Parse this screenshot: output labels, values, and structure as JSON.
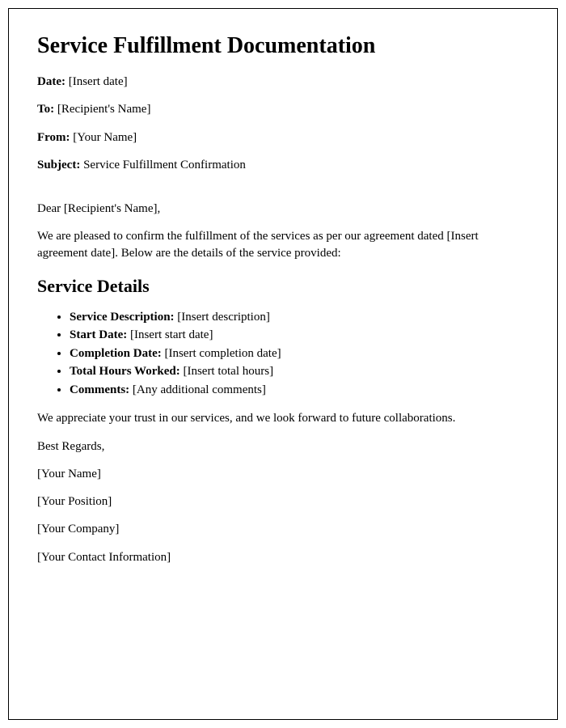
{
  "title": "Service Fulfillment Documentation",
  "header": {
    "date_label": "Date:",
    "date_value": " [Insert date]",
    "to_label": "To:",
    "to_value": " [Recipient's Name]",
    "from_label": "From:",
    "from_value": " [Your Name]",
    "subject_label": "Subject:",
    "subject_value": " Service Fulfillment Confirmation"
  },
  "salutation": "Dear [Recipient's Name],",
  "intro": "We are pleased to confirm the fulfillment of the services as per our agreement dated [Insert agreement date]. Below are the details of the service provided:",
  "details_heading": "Service Details",
  "details": {
    "desc_label": "Service Description:",
    "desc_value": " [Insert description]",
    "start_label": "Start Date:",
    "start_value": " [Insert start date]",
    "complete_label": "Completion Date:",
    "complete_value": " [Insert completion date]",
    "hours_label": "Total Hours Worked:",
    "hours_value": " [Insert total hours]",
    "comments_label": "Comments:",
    "comments_value": " [Any additional comments]"
  },
  "closing": "We appreciate your trust in our services, and we look forward to future collaborations.",
  "signoff": {
    "regards": "Best Regards,",
    "name": "[Your Name]",
    "position": "[Your Position]",
    "company": "[Your Company]",
    "contact": "[Your Contact Information]"
  }
}
